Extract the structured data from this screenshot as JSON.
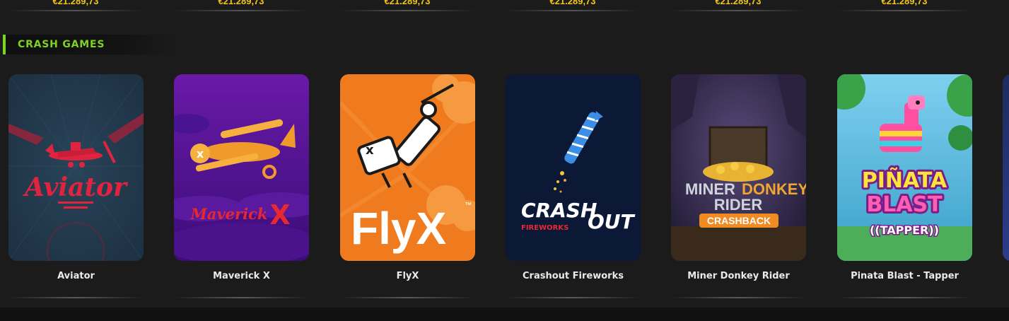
{
  "jackpots": [
    "€21.289,73",
    "€21.289,73",
    "€21.289,73",
    "€21.289,73",
    "€21.289,73",
    "€21.289,73"
  ],
  "section": {
    "title": "CRASH GAMES"
  },
  "games": [
    {
      "name": "Aviator",
      "art_text": "Aviator",
      "icon": "aviator-plane-icon"
    },
    {
      "name": "Maverick X",
      "art_text": "Maverick",
      "art_text_2": "X",
      "icon": "biplane-icon"
    },
    {
      "name": "FlyX",
      "art_text": "FlyX",
      "art_tm": "™",
      "icon": "flying-man-icon"
    },
    {
      "name": "Crashout Fireworks",
      "art_text": "CRASH",
      "art_text_2": "OUT",
      "art_text_3": "FIREWORKS",
      "icon": "firework-rocket-icon"
    },
    {
      "name": "Miner Donkey Rider",
      "art_text": "MINER",
      "art_text_2": "DONKEY",
      "art_text_3": "RIDER",
      "art_text_4": "CRASHBACK",
      "icon": "mine-cart-icon"
    },
    {
      "name": "Pinata Blast - Tapper",
      "art_text": "PIÑATA",
      "art_text_2": "BLAST",
      "art_text_3": "((TAPPER))",
      "icon": "pinata-llama-icon"
    }
  ],
  "colors": {
    "accent": "#7ed321",
    "jackpot": "#f0c419",
    "background": "#1b1b1b"
  }
}
